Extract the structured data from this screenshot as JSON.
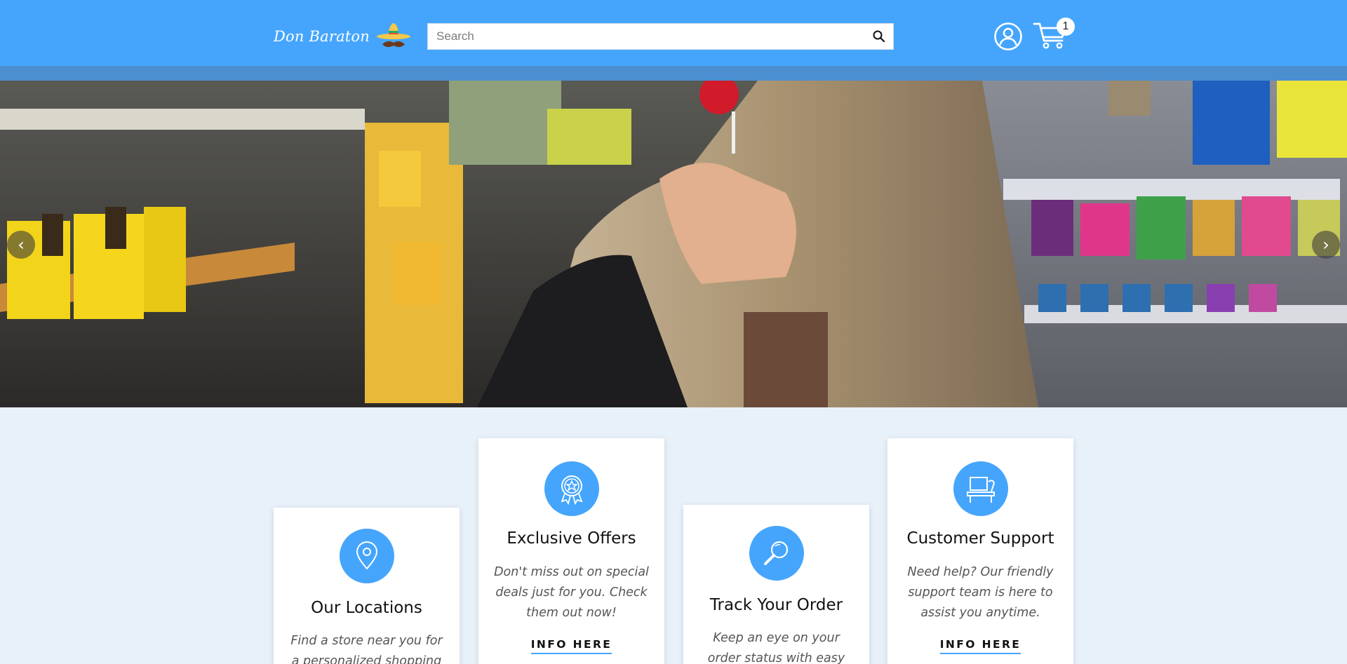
{
  "brand": {
    "name": "Don Baraton"
  },
  "search": {
    "placeholder": "Search"
  },
  "cart": {
    "count": "1"
  },
  "hero": {
    "prev_arrow": "‹",
    "next_arrow": "›"
  },
  "features": [
    {
      "title": "Our Locations",
      "text": "Find a store near you for a personalized shopping",
      "icon": "location-pin-icon"
    },
    {
      "title": "Exclusive Offers",
      "text": "Don't miss out on special deals just for you. Check them out now!",
      "link": "INFO HERE",
      "icon": "badge-star-icon"
    },
    {
      "title": "Track Your Order",
      "text": "Keep an eye on your order status with easy",
      "icon": "magnifier-icon"
    },
    {
      "title": "Customer Support",
      "text": "Need help? Our friendly support team is here to assist you anytime.",
      "link": "INFO HERE",
      "icon": "desk-support-icon"
    }
  ],
  "colors": {
    "header": "#45a5fc",
    "strip": "#4b8fd0",
    "page_bg": "#e8f0fa",
    "accent": "#45a5fc"
  }
}
